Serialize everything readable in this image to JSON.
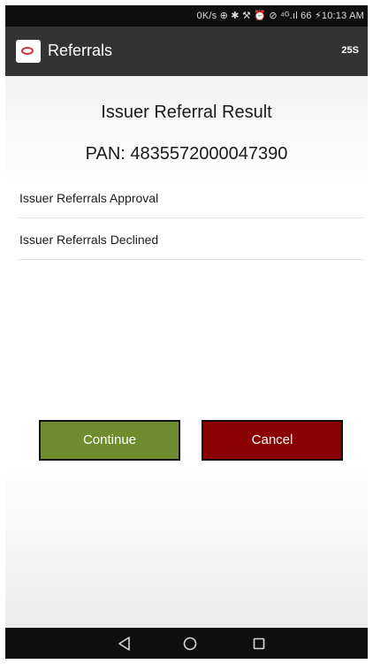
{
  "status_bar": {
    "text": "0K/s ⊕ ✱ ⚒ ⏰ ⊘ ⁴ᴳ.ıl 66 ⚡10:13 AM"
  },
  "app_bar": {
    "title": "Referrals",
    "timer": "25S",
    "logo_icon": "card-logo-icon"
  },
  "content": {
    "result_title": "Issuer Referral Result",
    "pan": "PAN: 4835572000047390",
    "items": [
      {
        "label": "Issuer Referrals Approval"
      },
      {
        "label": "Issuer Referrals Declined"
      }
    ]
  },
  "buttons": {
    "continue": "Continue",
    "cancel": "Cancel",
    "continue_color": "#6f8d2e",
    "cancel_color": "#8b0000"
  },
  "nav_bar": {
    "icons": [
      "back-icon",
      "home-icon",
      "recents-icon"
    ]
  }
}
